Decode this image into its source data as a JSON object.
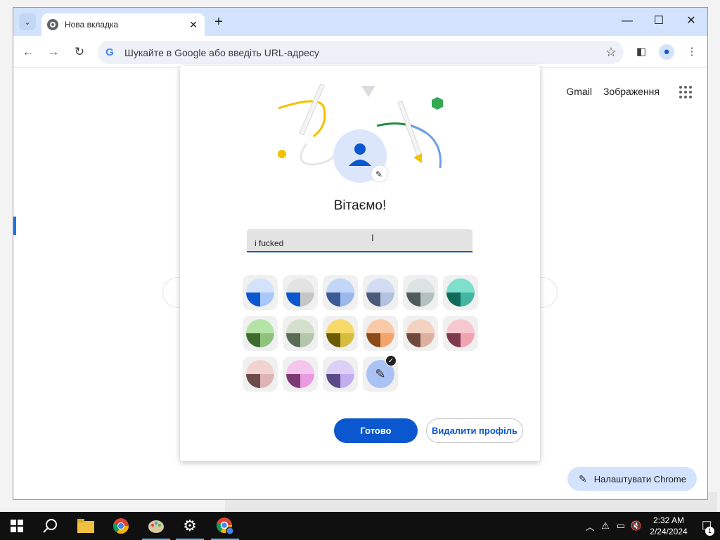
{
  "browser": {
    "tab_title": "Нова вкладка",
    "omnibox_placeholder": "Шукайте в Google або введіть URL-адресу"
  },
  "page": {
    "links": [
      "Gmail",
      "Зображення"
    ],
    "customize_label": "Налаштувати Chrome"
  },
  "dialog": {
    "title": "Вітаємо!",
    "name_value": "i fucked",
    "done_label": "Готово",
    "delete_label": "Видалити профіль",
    "swatches": [
      {
        "top": "#d3e3fd",
        "bl": "#0b57d0",
        "br": "#a8c7fa"
      },
      {
        "top": "#e3e3e3",
        "bl": "#0b57d0",
        "br": "#c4c7c5"
      },
      {
        "top": "#c2d7f8",
        "bl": "#3a5a98",
        "br": "#9ab8ea"
      },
      {
        "top": "#d1dcf2",
        "bl": "#4a5a78",
        "br": "#b2c2e0"
      },
      {
        "top": "#dce3e3",
        "bl": "#4f5b5b",
        "br": "#b4c0c0"
      },
      {
        "top": "#7ee0cc",
        "bl": "#0f6a5a",
        "br": "#44b5a0"
      },
      {
        "top": "#b5e3a6",
        "bl": "#3d6b30",
        "br": "#8fc27c"
      },
      {
        "top": "#d2e0cc",
        "bl": "#5a6a55",
        "br": "#b4c6ac"
      },
      {
        "top": "#f5da6a",
        "bl": "#6d5b00",
        "br": "#d6bd3c"
      },
      {
        "top": "#f9c9a8",
        "bl": "#8a4a1a",
        "br": "#f2a46a"
      },
      {
        "top": "#f4d2c2",
        "bl": "#6d4a3c",
        "br": "#deb0a0"
      },
      {
        "top": "#f8c8d0",
        "bl": "#7e3a4a",
        "br": "#f2a2b2"
      },
      {
        "top": "#f3d2d2",
        "bl": "#6b4a4a",
        "br": "#e0b4b4"
      },
      {
        "top": "#f4c6ee",
        "bl": "#7c3a72",
        "br": "#ea9ae0"
      },
      {
        "top": "#dcd0f7",
        "bl": "#5a4a8a",
        "br": "#c0aef0"
      }
    ],
    "picker_selected": true
  },
  "taskbar": {
    "time": "2:32 AM",
    "date": "2/24/2024",
    "notification_count": "1"
  },
  "colors": {
    "accent": "#0b57d0",
    "tabstrip": "#d3e3fd"
  }
}
